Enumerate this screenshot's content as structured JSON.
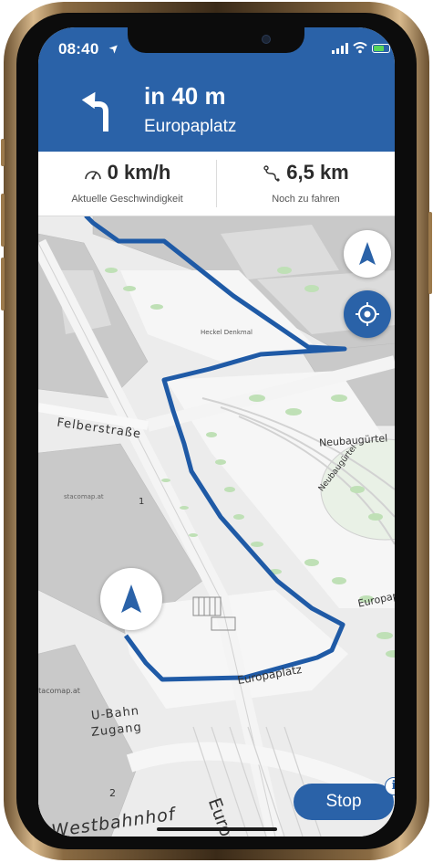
{
  "status_bar": {
    "time": "08:40",
    "location_glyph": "➤",
    "battery_color": "#58d65a"
  },
  "navigation": {
    "distance": "in 40 m",
    "street": "Europaplatz",
    "turn_icon": "turn-left-arrow-icon",
    "header_color": "#2a62a8"
  },
  "trip_info": {
    "speed_value": "0 km/h",
    "speed_label": "Aktuelle Geschwindigkeit",
    "remaining_value": "6,5 km",
    "remaining_label": "Noch zu fahren"
  },
  "map": {
    "street_labels": [
      "Felberstraße",
      "Neubaugürtel",
      "Neubaugürtel",
      "Europaplatz",
      "Europaplatz",
      "Westbahnhof",
      "Euro"
    ],
    "poi_labels": [
      "U-Bahn",
      "Zugang",
      "Heckel Denkmal"
    ],
    "attributions": [
      "stacomap.at",
      "stacomap.at"
    ],
    "building_numbers": [
      "1",
      "2"
    ],
    "route_color": "#1f5aa6"
  },
  "controls": {
    "stop_label": "Stop",
    "info_label": "i"
  }
}
